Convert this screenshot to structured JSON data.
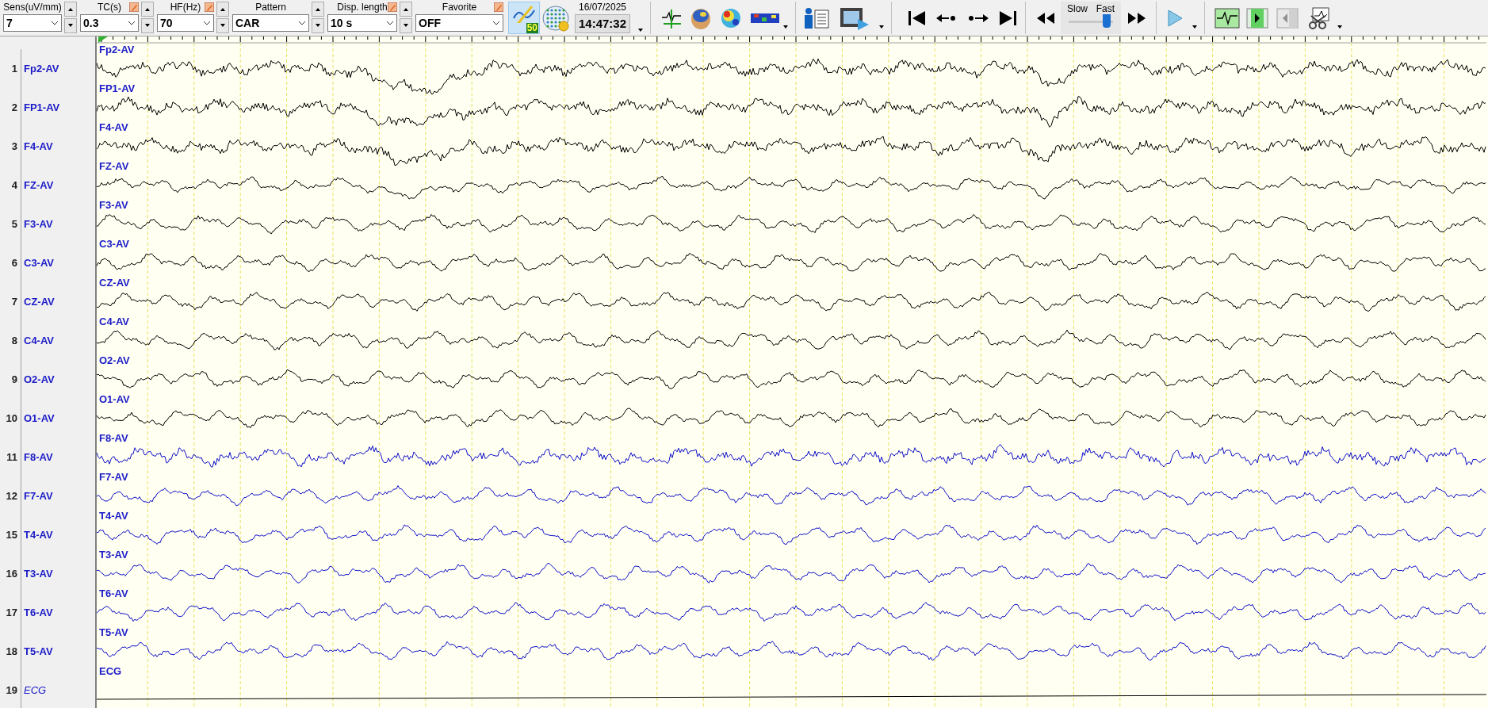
{
  "toolbar": {
    "controls": [
      {
        "label": "Sens(uV/mm)",
        "value": "7",
        "editable": false,
        "spinner": true
      },
      {
        "label": "TC(s)",
        "value": "0.3",
        "editable": true,
        "spinner": true
      },
      {
        "label": "HF(Hz)",
        "value": "70",
        "editable": true,
        "spinner": true
      },
      {
        "label": "Pattern",
        "value": "CAR",
        "editable": false,
        "spinner": true
      },
      {
        "label": "Disp. length",
        "value": "10 s",
        "editable": true,
        "spinner": true
      },
      {
        "label": "Favorite",
        "value": "OFF",
        "editable": true,
        "spinner": false
      }
    ],
    "notch_filter": {
      "label": "50",
      "selected": true
    },
    "date": "16/07/2025",
    "time": "14:47:32",
    "speed": {
      "slow_label": "Slow",
      "fast_label": "Fast",
      "level": 0.85
    }
  },
  "channels": [
    {
      "number": "1",
      "label": "Fp2-AV",
      "trace_label": "Fp2-AV",
      "kind": "eeg",
      "color": "#000000"
    },
    {
      "number": "2",
      "label": "FP1-AV",
      "trace_label": "FP1-AV",
      "kind": "eeg",
      "color": "#000000"
    },
    {
      "number": "3",
      "label": "F4-AV",
      "trace_label": "F4-AV",
      "kind": "eeg",
      "color": "#000000"
    },
    {
      "number": "4",
      "label": "FZ-AV",
      "trace_label": "FZ-AV",
      "kind": "eeg",
      "color": "#000000"
    },
    {
      "number": "5",
      "label": "F3-AV",
      "trace_label": "F3-AV",
      "kind": "eeg",
      "color": "#000000"
    },
    {
      "number": "6",
      "label": "C3-AV",
      "trace_label": "C3-AV",
      "kind": "eeg",
      "color": "#000000"
    },
    {
      "number": "7",
      "label": "CZ-AV",
      "trace_label": "CZ-AV",
      "kind": "eeg",
      "color": "#000000"
    },
    {
      "number": "8",
      "label": "C4-AV",
      "trace_label": "C4-AV",
      "kind": "eeg",
      "color": "#000000"
    },
    {
      "number": "9",
      "label": "O2-AV",
      "trace_label": "O2-AV",
      "kind": "eeg",
      "color": "#000000"
    },
    {
      "number": "10",
      "label": "O1-AV",
      "trace_label": "O1-AV",
      "kind": "eeg",
      "color": "#000000"
    },
    {
      "number": "11",
      "label": "F8-AV",
      "trace_label": "F8-AV",
      "kind": "eeg",
      "color": "#1010c8"
    },
    {
      "number": "12",
      "label": "F7-AV",
      "trace_label": "F7-AV",
      "kind": "eeg",
      "color": "#1010c8"
    },
    {
      "number": "15",
      "label": "T4-AV",
      "trace_label": "T4-AV",
      "kind": "eeg",
      "color": "#1010c8"
    },
    {
      "number": "16",
      "label": "T3-AV",
      "trace_label": "T3-AV",
      "kind": "eeg",
      "color": "#1010c8"
    },
    {
      "number": "17",
      "label": "T6-AV",
      "trace_label": "T6-AV",
      "kind": "eeg",
      "color": "#1010c8"
    },
    {
      "number": "18",
      "label": "T5-AV",
      "trace_label": "T5-AV",
      "kind": "eeg",
      "color": "#1010c8"
    },
    {
      "number": "19",
      "label": "ECG",
      "trace_label": "ECG",
      "kind": "ecg",
      "color": "#000000"
    }
  ]
}
